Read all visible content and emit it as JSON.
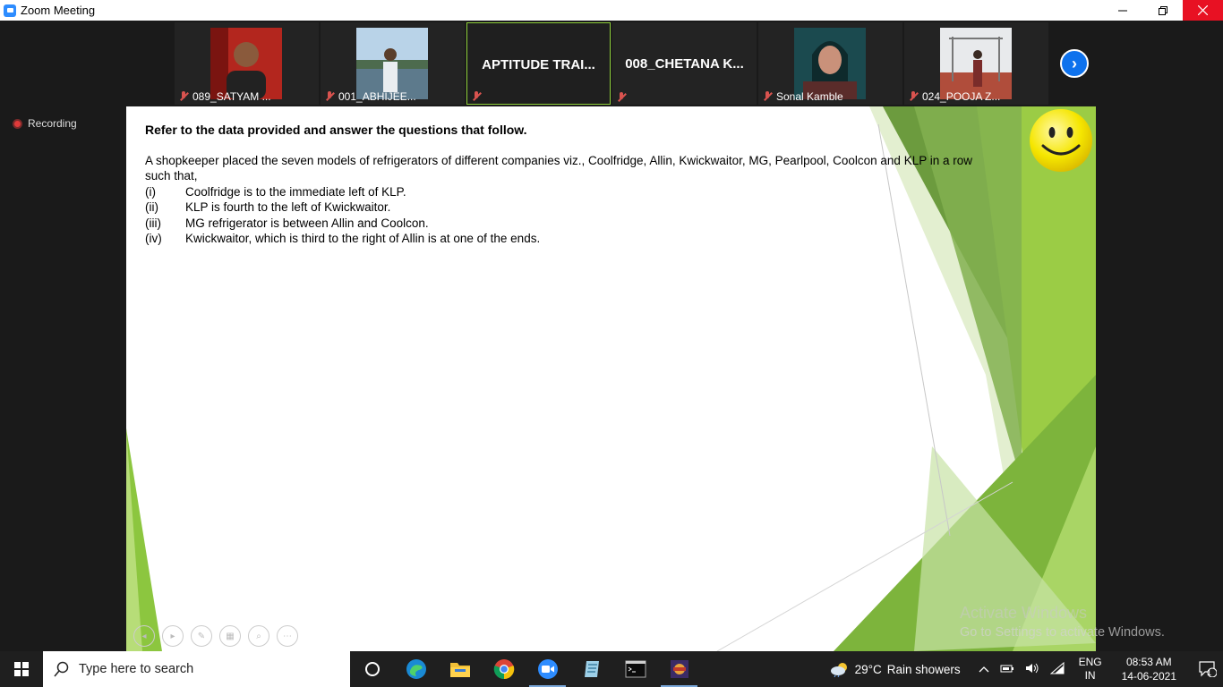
{
  "window": {
    "title": "Zoom Meeting"
  },
  "participants": [
    {
      "name": "089_SATYAM ...",
      "type": "video"
    },
    {
      "name": "001_ABHIJEE...",
      "type": "video"
    },
    {
      "name": "",
      "display_name": "APTITUDE TRAI...",
      "type": "name"
    },
    {
      "name": "",
      "display_name": "008_CHETANA  K...",
      "type": "name"
    },
    {
      "name": "Sonal Kamble",
      "type": "video"
    },
    {
      "name": "024_POOJA Z...",
      "type": "video"
    }
  ],
  "recording": {
    "label": "Recording"
  },
  "slide": {
    "heading": "Refer to the data provided and answer the questions that follow.",
    "intro": "A shopkeeper placed the seven models of refrigerators of different companies viz., Coolfridge, Allin, Kwickwaitor, MG, Pearlpool, Coolcon and KLP in a row such that,",
    "clues": [
      {
        "num": "(i)",
        "text": "Coolfridge is to the immediate left of KLP."
      },
      {
        "num": "(ii)",
        "text": "KLP is fourth to the left of Kwickwaitor."
      },
      {
        "num": "(iii)",
        "text": "MG refrigerator is between Allin and Coolcon."
      },
      {
        "num": "(iv)",
        "text": "Kwickwaitor, which is third to the right of Allin is at one of the ends."
      }
    ]
  },
  "watermark": {
    "line1": "Activate Windows",
    "line2": "Go to Settings to activate Windows."
  },
  "taskbar": {
    "search_placeholder": "Type here to search",
    "weather": {
      "temp": "29°C",
      "desc": "Rain showers"
    },
    "lang": {
      "top": "ENG",
      "bottom": "IN"
    },
    "clock": {
      "time": "08:53 AM",
      "date": "14-06-2021"
    },
    "notifications": "1"
  }
}
